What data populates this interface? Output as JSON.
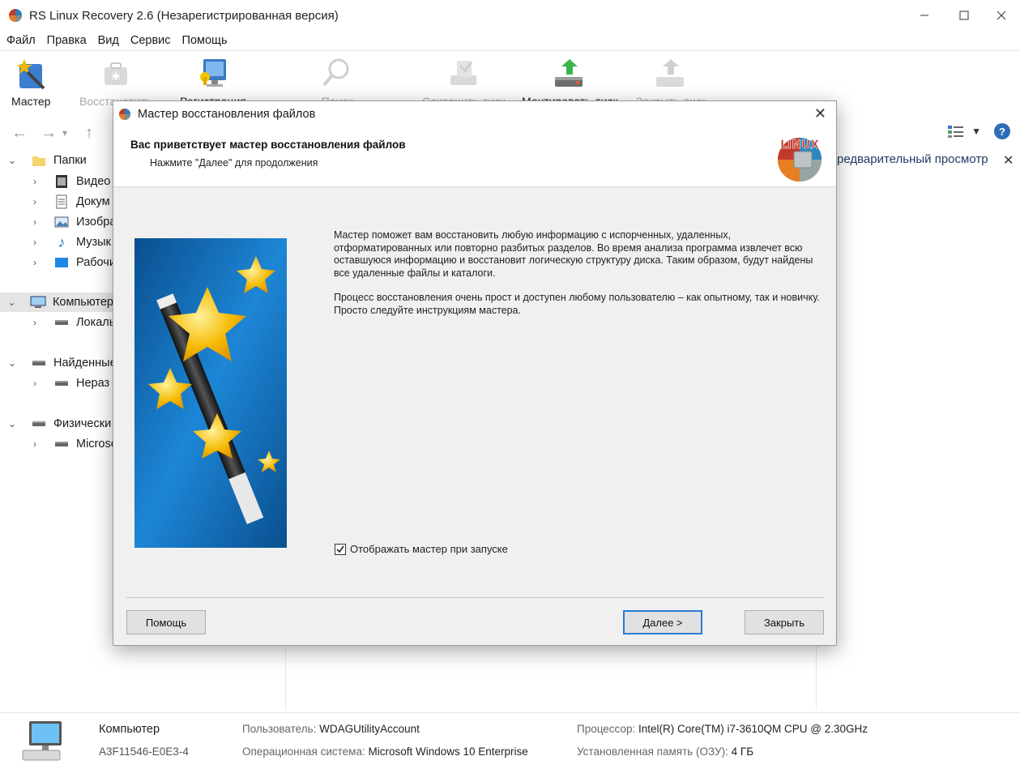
{
  "window": {
    "title": "RS Linux Recovery 2.6 (Незарегистрированная версия)",
    "controls": {
      "minimize": "—",
      "maximize": "☐",
      "close": "✕"
    }
  },
  "menu": [
    "Файл",
    "Правка",
    "Вид",
    "Сервис",
    "Помощь"
  ],
  "toolbar": {
    "master": "Мастер",
    "restore": "Восстановить",
    "register": "Регистрация",
    "search": "Поиск",
    "save_disk": "Сохранить диск",
    "mount_disk": "Монтировать диск",
    "close_disk": "Закрыть диск"
  },
  "nav": {
    "back": "←",
    "forward": "→",
    "dropdown": "▾",
    "up": "↑",
    "help": "?"
  },
  "tree": {
    "folders": "Папки",
    "video": "Видео",
    "documents": "Докум",
    "images": "Изобра",
    "music": "Музык",
    "desktop": "Рабочи",
    "computer": "Компьютер",
    "local": "Локаль",
    "found": "Найденные",
    "unallocated": "Нераз",
    "physical": "Физически",
    "microsoft": "Microso"
  },
  "preview": {
    "title": "редварительный просмотр",
    "close": "✕"
  },
  "status": {
    "computer": "Компьютер",
    "id": "A3F11546-E0E3-4",
    "user_label": "Пользователь:",
    "user_value": "WDAGUtilityAccount",
    "os_label": "Операционная система:",
    "os_value": "Microsoft Windows 10 Enterprise",
    "cpu_label": "Процессор:",
    "cpu_value": "Intel(R) Core(TM) i7-3610QM CPU @ 2.30GHz",
    "ram_label": "Установленная память (ОЗУ):",
    "ram_value": "4 ГБ"
  },
  "dialog": {
    "title": "Мастер восстановления файлов",
    "close": "✕",
    "heading": "Вас приветствует мастер восстановления файлов",
    "subheading": "Нажмите \"Далее\" для продолжения",
    "logo_text": "LINUX",
    "paragraph1": "Мастер поможет вам восстановить любую информацию с испорченных, удаленных, отформатированных или повторно разбитых разделов. Во время анализа программа извлечет всю оставшуюся информацию и восстановит логическую структуру диска. Таким образом, будут найдены все удаленные файлы и каталоги.",
    "paragraph2": "Процесс восстановления очень прост и доступен любому пользователю – как опытному, так и новичку. Просто следуйте инструкциям мастера.",
    "show_on_start": "Отображать мастер при запуске",
    "show_on_start_checked": true,
    "btn_help": "Помощь",
    "btn_next": "Далее >",
    "btn_close": "Закрыть"
  },
  "colors": {
    "accent": "#2b7bd6",
    "wizard_bg": "#0f62a8",
    "star": "#f5b800"
  }
}
